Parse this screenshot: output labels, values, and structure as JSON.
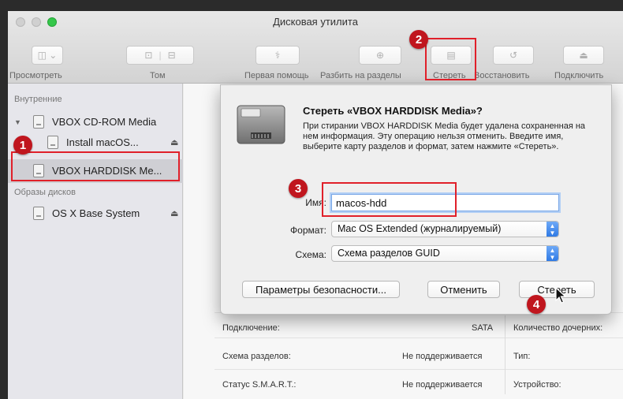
{
  "window": {
    "title": "Дисковая утилита"
  },
  "toolbar": {
    "view_label": "Просмотреть",
    "volume_label": "Том",
    "first_aid_label": "Первая помощь",
    "partition_label": "Разбить на разделы",
    "erase_label": "Стереть",
    "restore_label": "Восстановить",
    "mount_label": "Подключить"
  },
  "sidebar": {
    "internal_header": "Внутренние",
    "images_header": "Образы дисков",
    "items": [
      {
        "label": "VBOX CD-ROM Media"
      },
      {
        "label": "Install macOS..."
      },
      {
        "label": "VBOX HARDDISK Me..."
      },
      {
        "label": "OS X Base System"
      }
    ],
    "eject_glyph": "⏏"
  },
  "dialog": {
    "title": "Стереть «VBOX HARDDISK Media»?",
    "description": "При стирании VBOX HARDDISK Media будет удалена сохраненная на нем информация. Эту операцию нельзя отменить. Введите имя, выберите карту разделов и формат, затем нажмите «Стереть».",
    "name_label": "Имя:",
    "name_value": "macos-hdd",
    "format_label": "Формат:",
    "format_value": "Mac OS Extended (журналируемый)",
    "scheme_label": "Схема:",
    "scheme_value": "Схема разделов GUID",
    "security_button": "Параметры безопасности...",
    "cancel_button": "Отменить",
    "erase_button": "Стереть"
  },
  "info": {
    "rows": [
      {
        "label": "Подключение:",
        "value": "SATA",
        "right_label": "Количество дочерних:"
      },
      {
        "label": "Схема разделов:",
        "value": "Не поддерживается",
        "right_label": "Тип:"
      },
      {
        "label": "Статус S.M.A.R.T.:",
        "value": "Не поддерживается",
        "right_label": "Устройство:"
      }
    ]
  },
  "annotations": {
    "b1": "1",
    "b2": "2",
    "b3": "3",
    "b4": "4"
  },
  "colors": {
    "accent_red": "#e0202a",
    "badge_red": "#c0161e",
    "select_blue": "#2f7ae5"
  }
}
